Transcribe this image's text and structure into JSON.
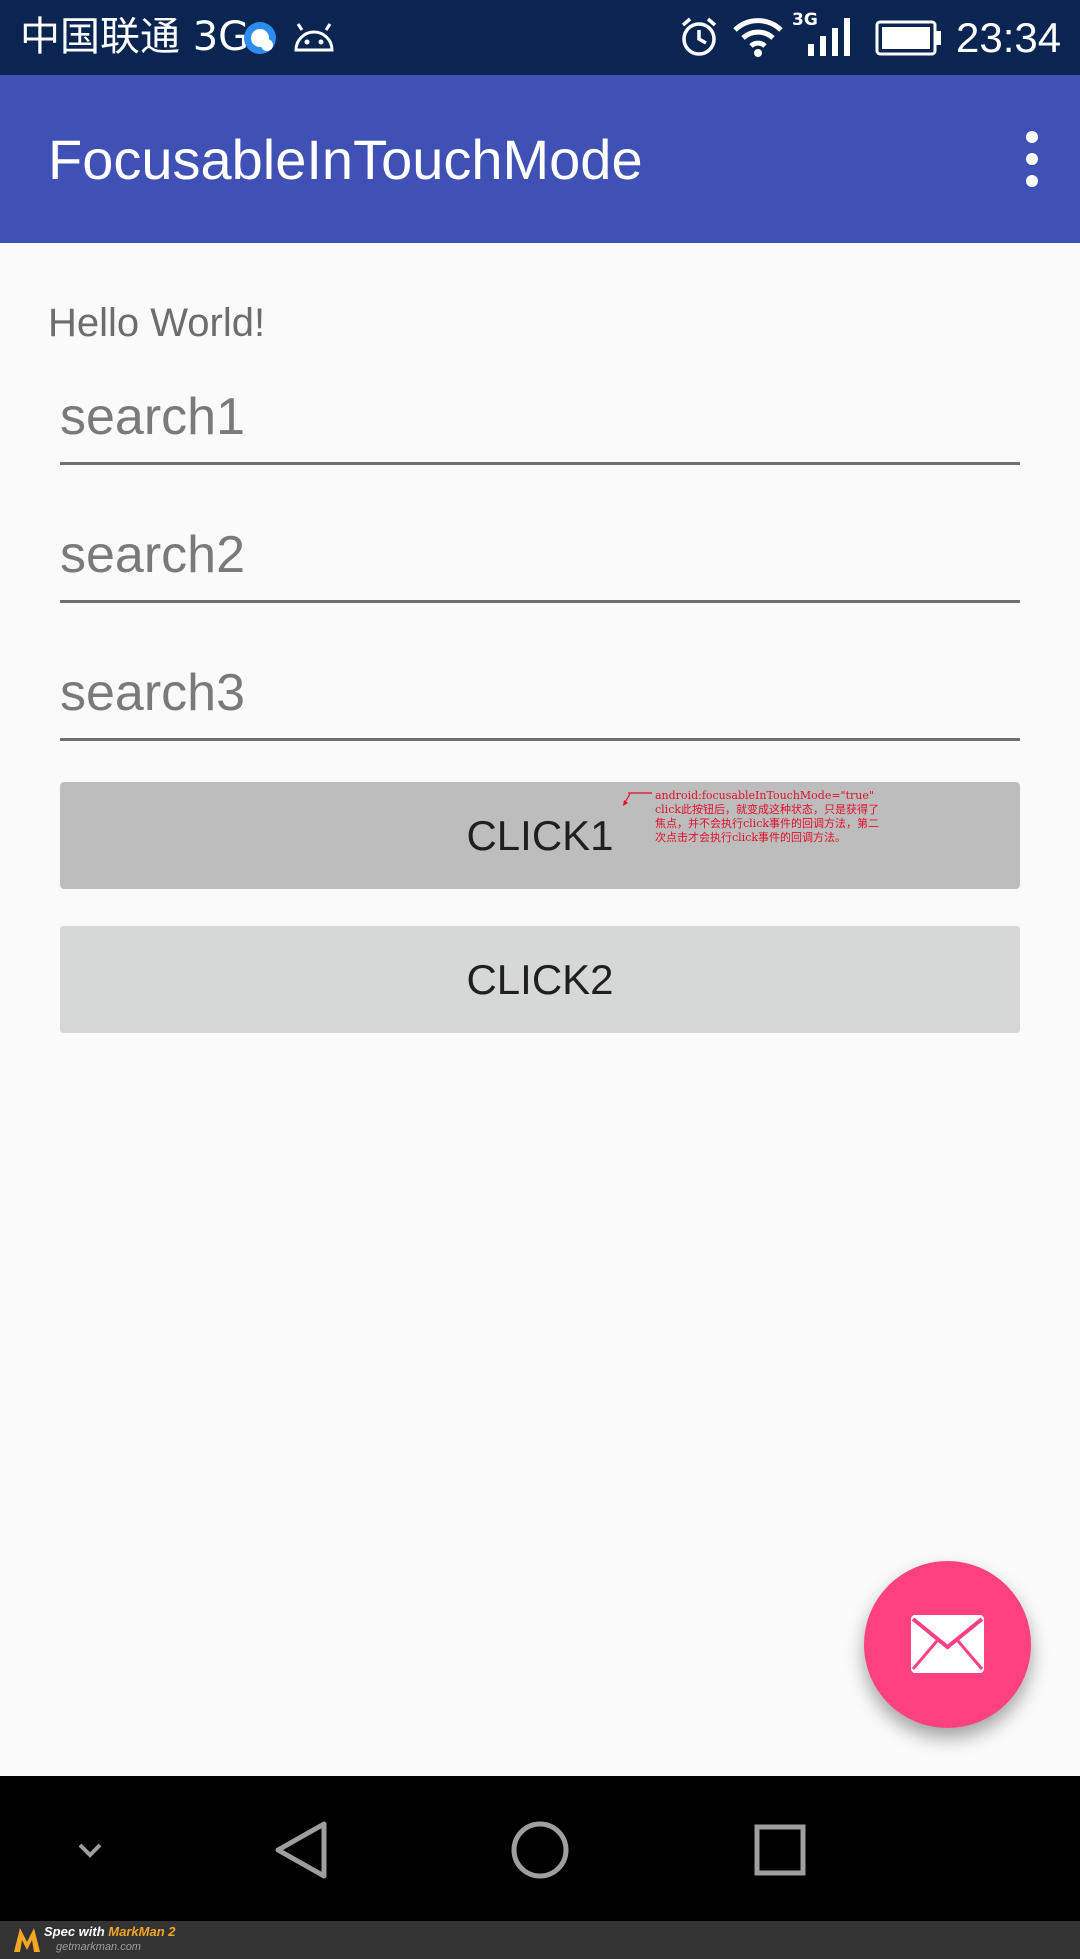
{
  "status_bar": {
    "carrier": "中国联通 3G",
    "network_badge": "3G",
    "time": "23:34",
    "icons": [
      "qq-icon",
      "android-icon",
      "alarm-icon",
      "wifi-icon",
      "signal-icon",
      "battery-icon"
    ]
  },
  "app_bar": {
    "title": "FocusableInTouchMode",
    "background": "#3f51b5",
    "menu_icon": "more-vert-icon"
  },
  "content": {
    "hello_text": "Hello World!",
    "search_fields": [
      {
        "placeholder": "search1",
        "value": ""
      },
      {
        "placeholder": "search2",
        "value": ""
      },
      {
        "placeholder": "search3",
        "value": ""
      }
    ],
    "buttons": [
      {
        "label": "CLICK1",
        "state": "focused"
      },
      {
        "label": "CLICK2",
        "state": "normal"
      }
    ],
    "annotation": "android:focusableInTouchMode=\"true\" click此按钮后，就变成这种状态，只是获得了焦点，并不会执行click事件的回调方法，第二次点击才会执行click事件的回调方法。"
  },
  "fab": {
    "icon": "email-icon",
    "color": "#ff4081"
  },
  "nav_bar": {
    "buttons": [
      "chevron-down-icon",
      "back-icon",
      "home-icon",
      "recents-icon"
    ]
  },
  "footer": {
    "prefix": "Spec with ",
    "brand": "MarkMan 2",
    "url": "getmarkman.com"
  }
}
